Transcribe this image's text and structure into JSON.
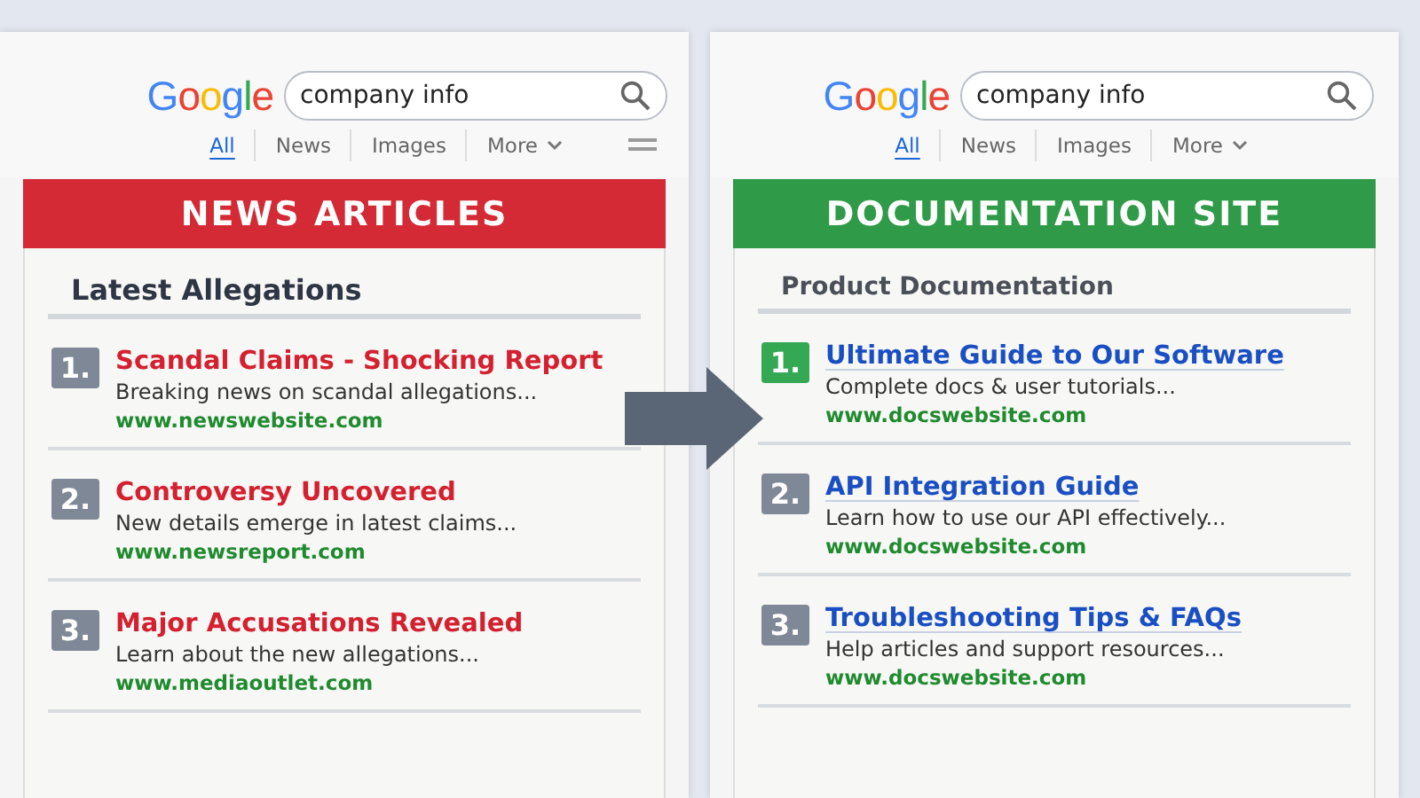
{
  "panels": [
    {
      "kind": "news",
      "logo": "Google",
      "query": "company info",
      "tabs": [
        {
          "label": "All",
          "selected": true
        },
        {
          "label": "News",
          "selected": false
        },
        {
          "label": "Images",
          "selected": false
        },
        {
          "label": "More",
          "selected": false,
          "kind": "dropdown"
        }
      ],
      "menu": true,
      "banner": "NEWS ARTICLES",
      "heading": "Latest Allegations",
      "results": [
        {
          "rank": "1.",
          "color": "#7f8896",
          "title": "Scandal Claims - Shocking Report",
          "snippet": "Breaking news on scandal allegations...",
          "url": "www.newswebsite.com"
        },
        {
          "rank": "2.",
          "color": "#7f8896",
          "title": "Controversy Uncovered",
          "snippet": "New details emerge in latest claims...",
          "url": "www.newsreport.com"
        },
        {
          "rank": "3.",
          "color": "#7f8896",
          "title": "Major Accusations Revealed",
          "snippet": "Learn about the new allegations...",
          "url": "www.mediaoutlet.com"
        }
      ]
    },
    {
      "kind": "docs",
      "logo": "Google",
      "query": "company info",
      "tabs": [
        {
          "label": "All",
          "selected": true
        },
        {
          "label": "News",
          "selected": false
        },
        {
          "label": "Images",
          "selected": false
        },
        {
          "label": "More",
          "selected": false,
          "kind": "dropdown"
        }
      ],
      "menu": false,
      "banner": "DOCUMENTATION SITE",
      "heading": "Product Documentation",
      "results": [
        {
          "rank": "1.",
          "color": "#34a853",
          "title": "Ultimate Guide to Our Software",
          "snippet": "Complete docs & user tutorials...",
          "url": "www.docswebsite.com"
        },
        {
          "rank": "2.",
          "color": "#7f8896",
          "title": "API Integration Guide",
          "snippet": "Learn how to use our API effectively...",
          "url": "www.docswebsite.com"
        },
        {
          "rank": "3.",
          "color": "#7f8896",
          "title": "Troubleshooting Tips & FAQs",
          "snippet": "Help articles and support resources...",
          "url": "www.docswebsite.com"
        }
      ]
    }
  ]
}
